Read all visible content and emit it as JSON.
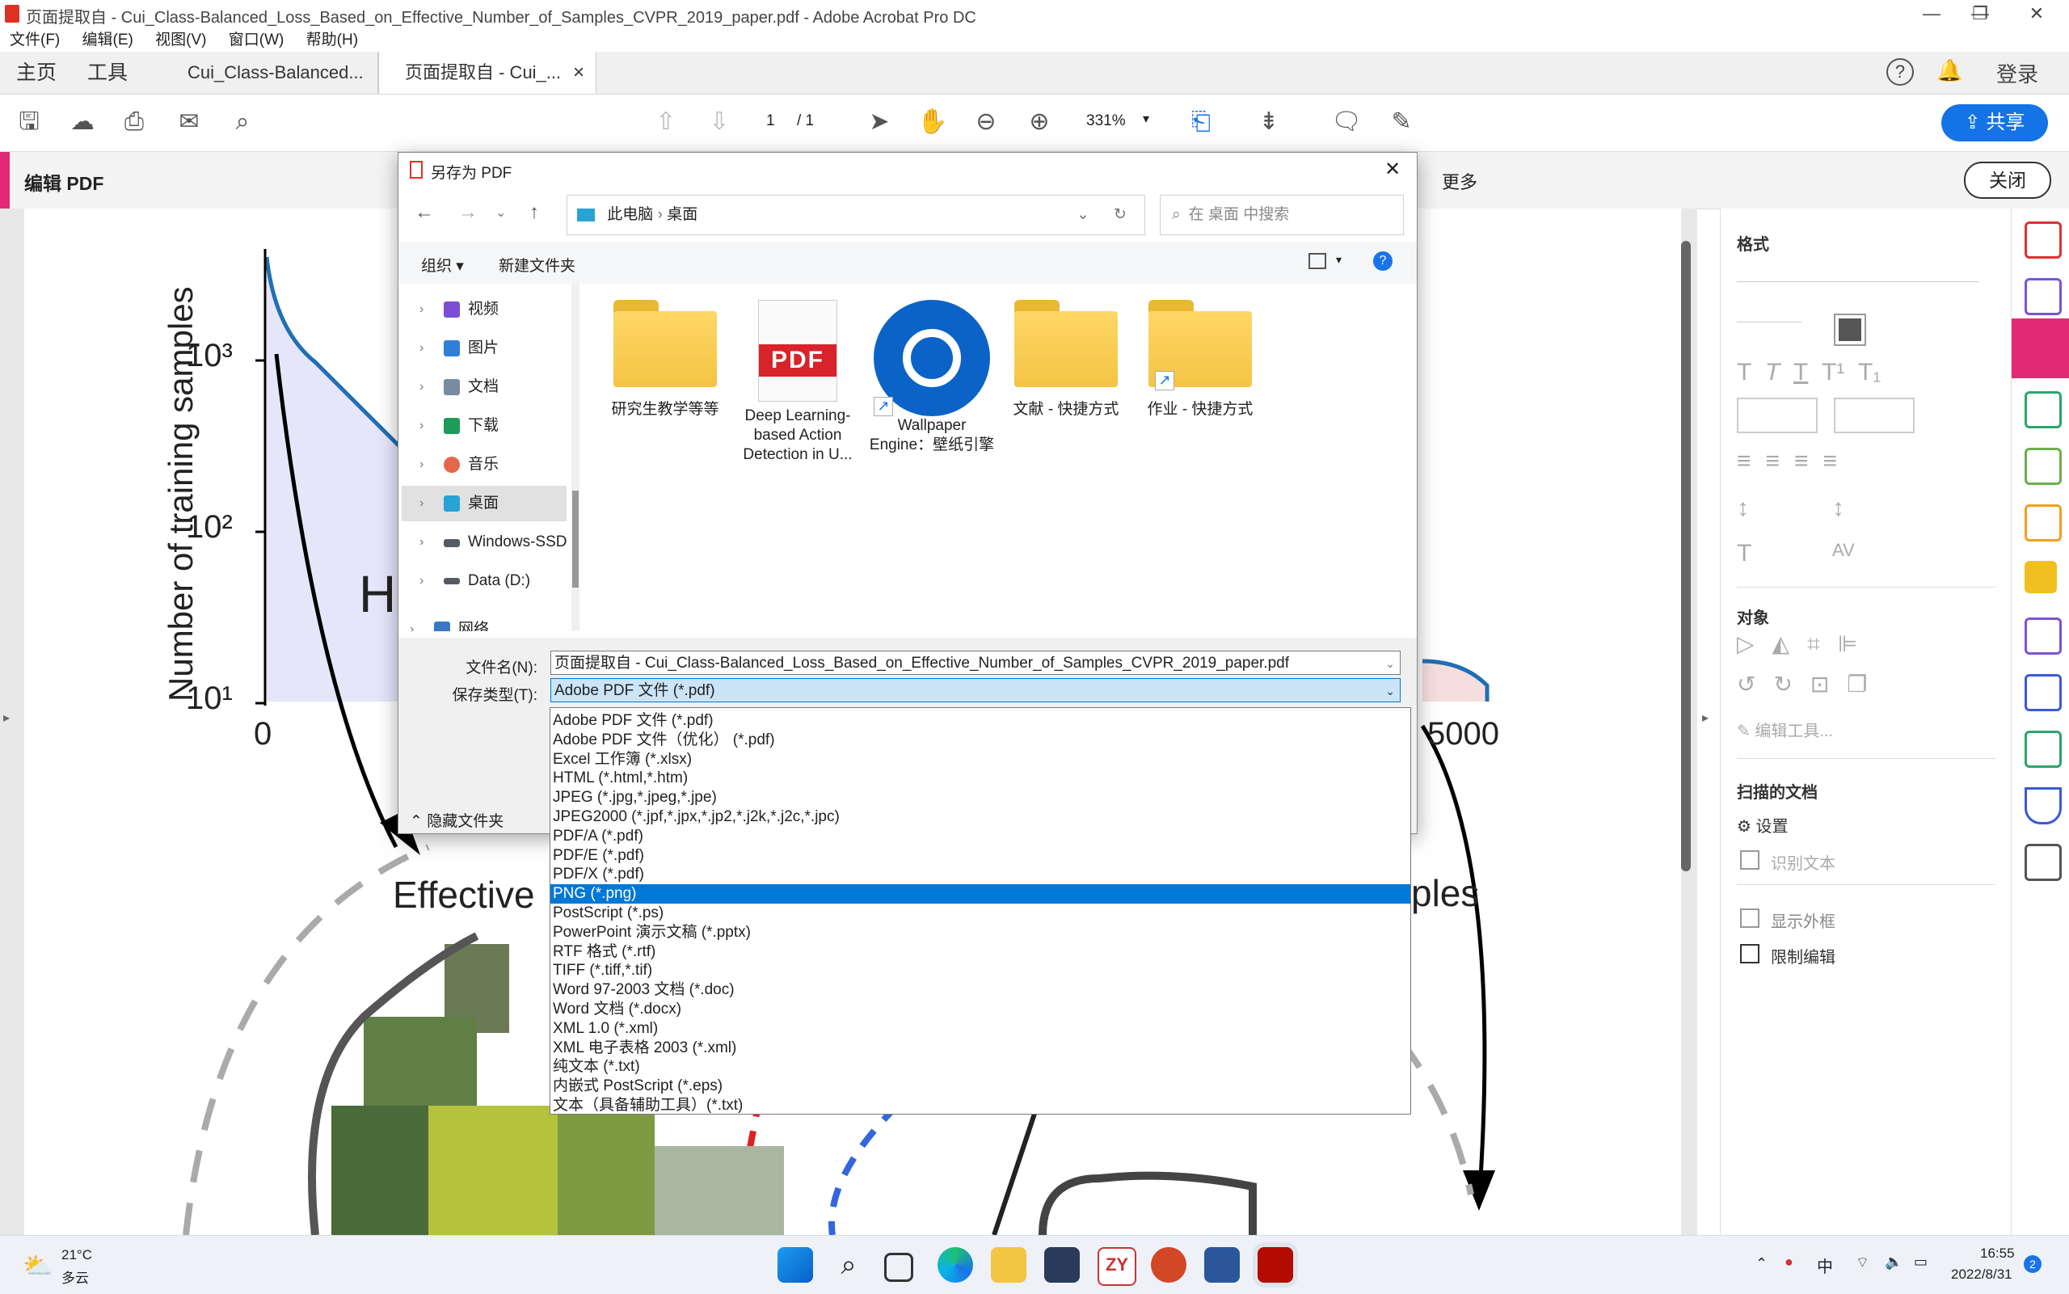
{
  "window": {
    "title": "页面提取自 - Cui_Class-Balanced_Loss_Based_on_Effective_Number_of_Samples_CVPR_2019_paper.pdf - Adobe Acrobat Pro DC",
    "minimize": "—",
    "restore": "❐",
    "close": "✕"
  },
  "menu": [
    "文件(F)",
    "编辑(E)",
    "视图(V)",
    "窗口(W)",
    "帮助(H)"
  ],
  "tabs": {
    "home": "主页",
    "tools": "工具",
    "doc1": "Cui_Class-Balanced...",
    "doc2": "页面提取自 - Cui_...",
    "doc2_close": "×",
    "help": "?",
    "login": "登录"
  },
  "toolbar": {
    "page_current": "1",
    "page_total": "/ 1",
    "zoom": "331%",
    "share": "共享"
  },
  "editbar": {
    "title": "编辑 PDF",
    "more": "更多",
    "close": "关闭"
  },
  "figure": {
    "ylabel": "Number of training samples",
    "yticks": [
      "10³",
      "10²",
      "10¹"
    ],
    "xticks": [
      "0",
      "5000"
    ],
    "partial_label": "H",
    "effective_text": "Effective",
    "ples_text": "ples"
  },
  "right_panel": {
    "format": "格式",
    "object": "对象",
    "edit_tool": "编辑工具...",
    "scanned": "扫描的文档",
    "settings": "设置",
    "recognize_text": "识别文本",
    "show_outline": "显示外框",
    "restrict_edit": "限制编辑"
  },
  "dialog": {
    "title": "另存为 PDF",
    "close": "✕",
    "breadcrumb": [
      "此电脑",
      "桌面"
    ],
    "search_placeholder": "在 桌面 中搜索",
    "organize": "组织",
    "new_folder": "新建文件夹",
    "nav_items": [
      {
        "label": "视频",
        "color": "#7a4fd6"
      },
      {
        "label": "图片",
        "color": "#2f7fd8"
      },
      {
        "label": "文档",
        "color": "#7a8aa0"
      },
      {
        "label": "下载",
        "color": "#1f9a5a"
      },
      {
        "label": "音乐",
        "color": "#e3674a"
      },
      {
        "label": "桌面",
        "color": "#29a3d6"
      },
      {
        "label": "Windows-SSD",
        "color": "#555a66"
      },
      {
        "label": "Data (D:)",
        "color": "#555a66"
      },
      {
        "label": "网络",
        "color": "#3b78c4"
      }
    ],
    "files": [
      {
        "name": "研究生教学等等",
        "type": "folder"
      },
      {
        "name": "Deep Learning-based Action Detection in U...",
        "type": "pdf"
      },
      {
        "name": "Wallpaper Engine：壁纸引擎",
        "type": "app"
      },
      {
        "name": "文献 - 快捷方式",
        "type": "folder-shortcut"
      },
      {
        "name": "作业 - 快捷方式",
        "type": "folder-shortcut"
      }
    ],
    "filename_label": "文件名(N):",
    "filename_value": "页面提取自 - Cui_Class-Balanced_Loss_Based_on_Effective_Number_of_Samples_CVPR_2019_paper.pdf",
    "filetype_label": "保存类型(T):",
    "filetype_value": "Adobe PDF 文件 (*.pdf)",
    "hide_folders": "隐藏文件夹",
    "file_types": [
      "Adobe PDF 文件 (*.pdf)",
      "Adobe PDF 文件（优化） (*.pdf)",
      "Excel 工作簿 (*.xlsx)",
      "HTML (*.html,*.htm)",
      "JPEG (*.jpg,*.jpeg,*.jpe)",
      "JPEG2000 (*.jpf,*.jpx,*.jp2,*.j2k,*.j2c,*.jpc)",
      "PDF/A (*.pdf)",
      "PDF/E (*.pdf)",
      "PDF/X (*.pdf)",
      "PNG (*.png)",
      "PostScript (*.ps)",
      "PowerPoint 演示文稿 (*.pptx)",
      "RTF 格式 (*.rtf)",
      "TIFF (*.tiff,*.tif)",
      "Word 97-2003 文档 (*.doc)",
      "Word 文档 (*.docx)",
      "XML 1.0 (*.xml)",
      "XML 电子表格 2003 (*.xml)",
      "纯文本 (*.txt)",
      "内嵌式 PostScript (*.eps)",
      "文本（具备辅助工具）(*.txt)"
    ],
    "selected_index": 9
  },
  "taskbar": {
    "weather_temp": "21°C",
    "weather_desc": "多云",
    "ime": "中",
    "time": "16:55",
    "date": "2022/8/31",
    "notification_count": "2"
  },
  "colors": {
    "accent_blue": "#1473e6",
    "edit_pink": "#e22a77",
    "selection": "#0078d7"
  }
}
